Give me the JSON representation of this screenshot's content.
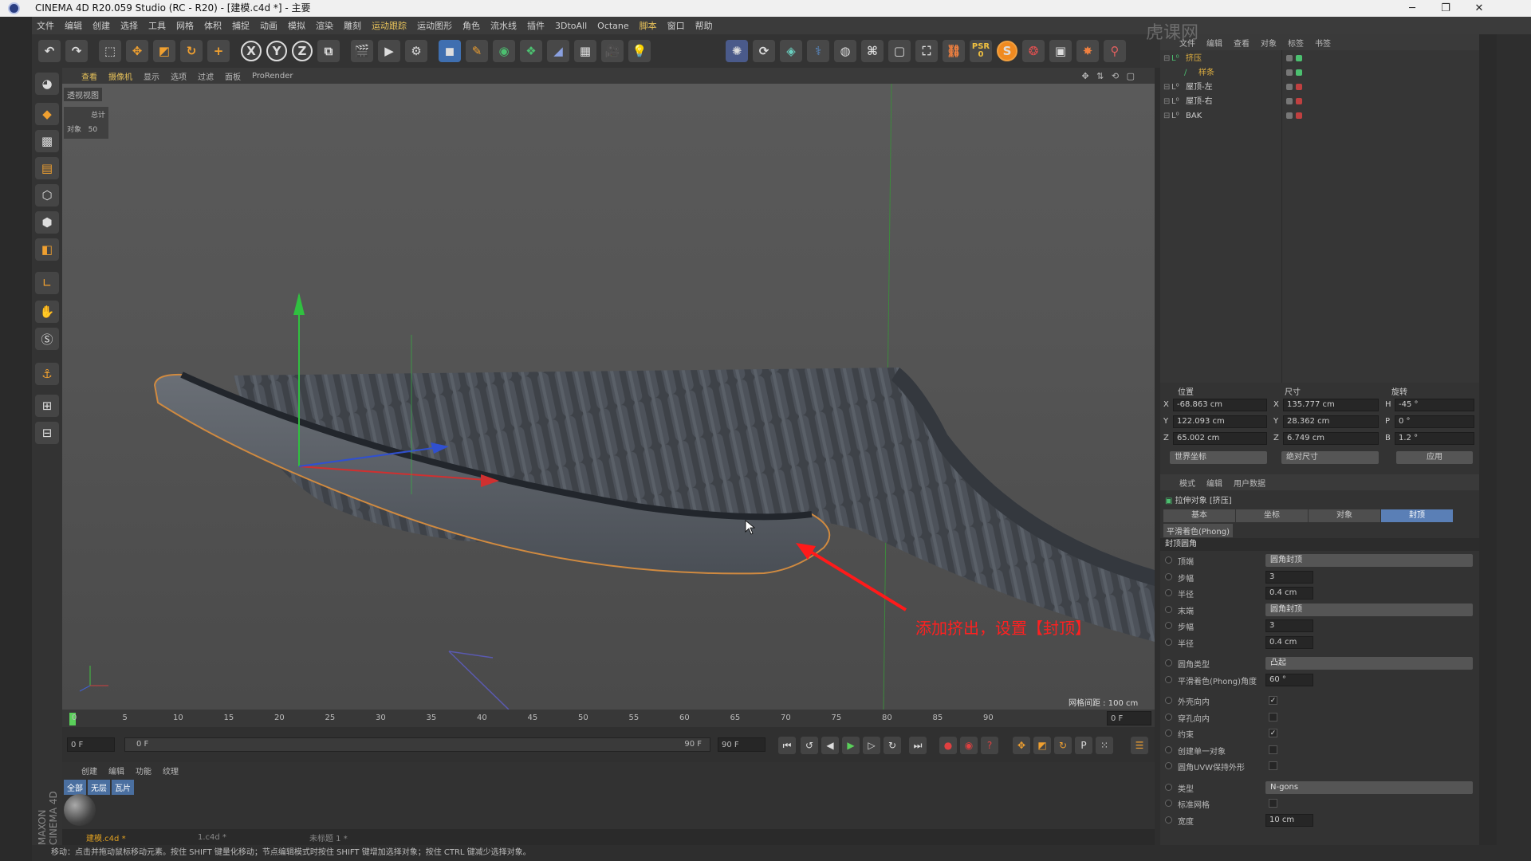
{
  "window": {
    "title": "CINEMA 4D R20.059 Studio (RC - R20) - [建模.c4d *] - 主要",
    "min": "─",
    "max": "❐",
    "close": "✕"
  },
  "menu": [
    "文件",
    "编辑",
    "创建",
    "选择",
    "工具",
    "网格",
    "体积",
    "捕捉",
    "动画",
    "模拟",
    "渲染",
    "雕刻",
    "运动跟踪",
    "运动图形",
    "角色",
    "流水线",
    "插件",
    "3DtoAll",
    "Octane",
    "脚本",
    "窗口",
    "帮助"
  ],
  "toolbar": {
    "x": "X",
    "y": "Y",
    "z": "Z",
    "psr": "PSR",
    "psr_val": "0"
  },
  "viewport": {
    "menu": [
      "查看",
      "摄像机",
      "显示",
      "选项",
      "过滤",
      "面板",
      "ProRender"
    ],
    "tag": "透视视图",
    "hud_title": "总计",
    "hud_label": "对象",
    "hud_value": "50",
    "grid_info": "网格间距 : 100 cm",
    "annotation": "添加挤出，设置【封顶】"
  },
  "timeline": {
    "ticks": [
      "0",
      "5",
      "10",
      "15",
      "20",
      "25",
      "30",
      "35",
      "40",
      "45",
      "50",
      "55",
      "60",
      "65",
      "70",
      "75",
      "80",
      "85",
      "90"
    ],
    "current": "0 F",
    "start": "0 F",
    "slider_start": "0 F",
    "slider_end": "90 F",
    "end": "90 F"
  },
  "material": {
    "menu": [
      "创建",
      "编辑",
      "功能",
      "纹理"
    ],
    "tabs": [
      "全部",
      "无层",
      "瓦片"
    ]
  },
  "filetabs": [
    "建模.c4d *",
    "1.c4d *",
    "未标题 1 *"
  ],
  "statusbar": "移动：点击并拖动鼠标移动元素。按住 SHIFT 键量化移动；节点编辑模式时按住 SHIFT 键增加选择对象；按住 CTRL 键减少选择对象。",
  "objects": {
    "menu": [
      "文件",
      "编辑",
      "查看",
      "对象",
      "标签",
      "书签"
    ],
    "rows": [
      {
        "name": "挤压",
        "color": "#e0b040"
      },
      {
        "name": "样条",
        "color": "#e0b040"
      },
      {
        "name": "屋顶-左",
        "color": "#cccccc"
      },
      {
        "name": "屋顶-右",
        "color": "#cccccc"
      },
      {
        "name": "BAK",
        "color": "#cccccc"
      }
    ]
  },
  "coords": {
    "headers": [
      "位置",
      "尺寸",
      "旋转"
    ],
    "rows": [
      {
        "axis": "X",
        "pos": "-68.863 cm",
        "size_axis": "X",
        "size": "135.777 cm",
        "rot_axis": "H",
        "rot": "-45 °"
      },
      {
        "axis": "Y",
        "pos": "122.093 cm",
        "size_axis": "Y",
        "size": "28.362 cm",
        "rot_axis": "P",
        "rot": "0 °"
      },
      {
        "axis": "Z",
        "pos": "65.002 cm",
        "size_axis": "Z",
        "size": "6.749 cm",
        "rot_axis": "B",
        "rot": "1.2 °"
      }
    ],
    "mode1": "世界坐标",
    "mode2": "绝对尺寸",
    "apply": "应用"
  },
  "attributes": {
    "menu": [
      "模式",
      "编辑",
      "用户数据"
    ],
    "title": "拉伸对象 [挤压]",
    "tabs": [
      "基本",
      "坐标",
      "对象",
      "封顶"
    ],
    "phong": "平滑着色(Phong)",
    "section": "封顶圆角",
    "rows": [
      {
        "label": "顶端",
        "type": "drop",
        "value": "圆角封顶"
      },
      {
        "label": "步幅",
        "type": "val",
        "value": "3"
      },
      {
        "label": "半径",
        "type": "val",
        "value": "0.4 cm"
      },
      {
        "label": "末端",
        "type": "drop",
        "value": "圆角封顶"
      },
      {
        "label": "步幅",
        "type": "val",
        "value": "3"
      },
      {
        "label": "半径",
        "type": "val",
        "value": "0.4 cm"
      },
      {
        "label": "圆角类型",
        "type": "drop",
        "value": "凸起"
      },
      {
        "label": "平滑着色(Phong)角度",
        "type": "val",
        "value": "60 °"
      },
      {
        "label": "外壳向内",
        "type": "chk",
        "value": "✓"
      },
      {
        "label": "穿孔向内",
        "type": "chk",
        "value": ""
      },
      {
        "label": "约束",
        "type": "chk",
        "value": "✓"
      },
      {
        "label": "创建单一对象",
        "type": "chk",
        "value": ""
      },
      {
        "label": "圆角UVW保持外形",
        "type": "chk",
        "value": ""
      },
      {
        "label": "类型",
        "type": "drop",
        "value": "N-gons"
      },
      {
        "label": "标准网格",
        "type": "chk",
        "value": ""
      },
      {
        "label": "宽度",
        "type": "val",
        "value": "10 cm"
      }
    ]
  },
  "watermark": "虎课网",
  "brand": "MAXON CINEMA 4D"
}
